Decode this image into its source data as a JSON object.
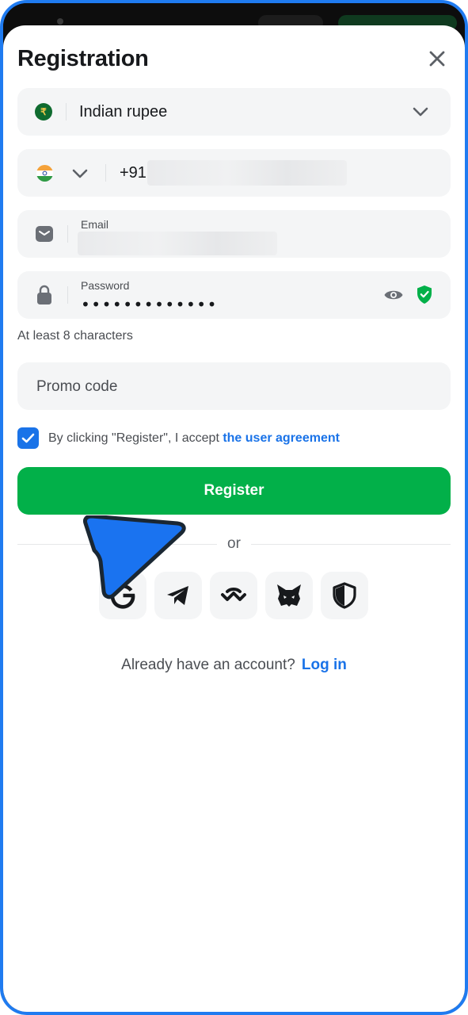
{
  "header": {
    "title": "Registration",
    "close_icon": "close-icon"
  },
  "currency": {
    "flag_symbol": "₹",
    "label": "Indian rupee",
    "icon": "chevron-down-icon"
  },
  "phone": {
    "country_flag": "india-flag-icon",
    "dial_code": "+91",
    "value_obscured": true
  },
  "email": {
    "label": "Email",
    "value_obscured": true
  },
  "password": {
    "label": "Password",
    "masked_value": "•••••••••••••",
    "show_icon": "eye-icon",
    "strength_icon": "shield-check-icon"
  },
  "password_hint": "At least 8 characters",
  "promo": {
    "placeholder": "Promo code"
  },
  "agreement": {
    "checked": true,
    "text": "By clicking \"Register\", I accept ",
    "link_text": "the user agreement"
  },
  "register_button": "Register",
  "divider_text": "or",
  "social_logins": [
    {
      "name": "Google",
      "icon": "google-icon"
    },
    {
      "name": "Telegram",
      "icon": "telegram-icon"
    },
    {
      "name": "WalletConnect",
      "icon": "walletconnect-icon"
    },
    {
      "name": "MetaMask",
      "icon": "metamask-fox-icon"
    },
    {
      "name": "Shield",
      "icon": "shield-icon"
    }
  ],
  "footer": {
    "prompt": "Already have an account?",
    "login_link": "Log in"
  },
  "colors": {
    "accent_blue": "#1a73e8",
    "register_green": "#02b049",
    "frame_blue": "#1f7bf0",
    "field_bg": "#f4f5f6"
  }
}
